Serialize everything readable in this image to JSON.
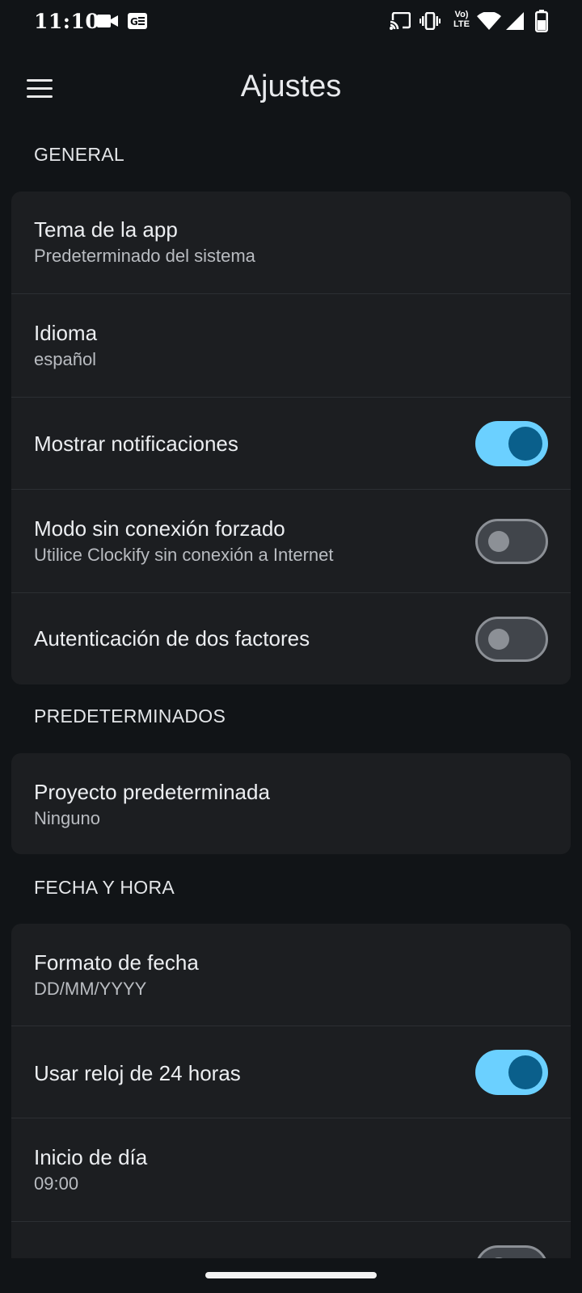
{
  "status_bar": {
    "time": "11:10",
    "network_label": "Vo) LTE",
    "icons": [
      "video-icon",
      "news-icon",
      "cast-icon",
      "vibrate-icon",
      "volte-icon",
      "wifi-icon",
      "signal-icon",
      "battery-icon"
    ]
  },
  "app_bar": {
    "title": "Ajustes",
    "menu_icon": "menu-icon"
  },
  "sections": {
    "general": {
      "header": "GENERAL",
      "items": [
        {
          "title": "Tema de la app",
          "subtitle": "Predeterminado del sistema"
        },
        {
          "title": "Idioma",
          "subtitle": "español"
        },
        {
          "title": "Mostrar notificaciones",
          "toggle": true
        },
        {
          "title": "Modo sin conexión forzado",
          "subtitle": "Utilice Clockify sin conexión a Internet",
          "toggle": false
        },
        {
          "title": "Autenticación de dos factores",
          "toggle": false
        }
      ]
    },
    "defaults": {
      "header": "PREDETERMINADOS",
      "items": [
        {
          "title": "Proyecto predeterminada",
          "subtitle": "Ninguno"
        }
      ]
    },
    "datetime": {
      "header": "FECHA Y HORA",
      "items": [
        {
          "title": "Formato de fecha",
          "subtitle": "DD/MM/YYYY"
        },
        {
          "title": "Usar reloj de 24 horas",
          "toggle": true
        },
        {
          "title": "Inicio de día",
          "subtitle": "09:00"
        },
        {
          "title": "",
          "toggle": false
        }
      ]
    }
  },
  "colors": {
    "background": "#111417",
    "card": "#1c1e21",
    "toggle_on_track": "#6bd0ff",
    "toggle_on_knob": "#0a5f8b",
    "toggle_off_track": "#41454b",
    "toggle_off_border": "#8c9096"
  }
}
